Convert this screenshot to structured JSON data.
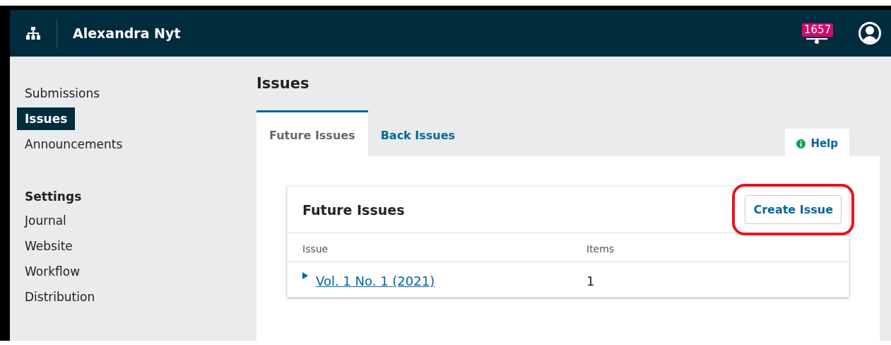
{
  "header": {
    "journal": "Alexandra Nyt",
    "notification_count": "1657"
  },
  "sidebar": {
    "items": [
      {
        "label": "Submissions",
        "selected": false
      },
      {
        "label": "Issues",
        "selected": true
      },
      {
        "label": "Announcements",
        "selected": false
      }
    ],
    "settings": {
      "heading": "Settings",
      "items": [
        {
          "label": "Journal",
          "selected": false
        },
        {
          "label": "Website",
          "selected": false
        },
        {
          "label": "Workflow",
          "selected": false
        },
        {
          "label": "Distribution",
          "selected": false
        }
      ]
    }
  },
  "page_title": "Issues",
  "tabs": [
    {
      "label": "Future Issues",
      "selected": true
    },
    {
      "label": "Back Issues",
      "selected": false
    }
  ],
  "help": "Help",
  "card": {
    "title": "Future Issues",
    "button": {
      "label": "Create Issue",
      "highlighted": true
    },
    "columns": [
      "Issue",
      "Items"
    ],
    "rows": [
      {
        "issue": "Vol. 1 No. 1 (2021)",
        "items": "1",
        "expanded": false
      }
    ]
  }
}
